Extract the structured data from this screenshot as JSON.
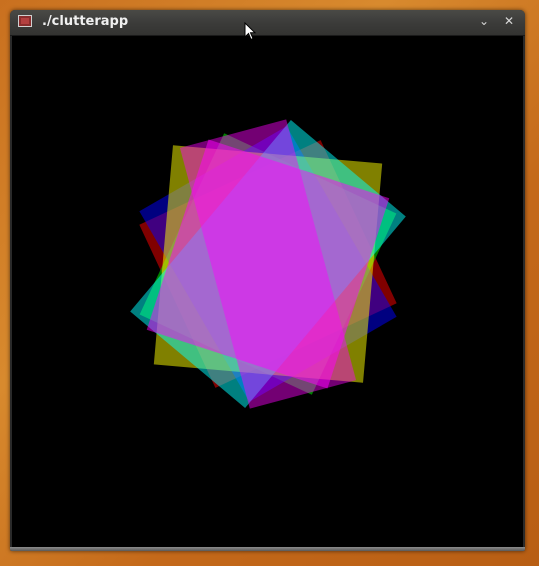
{
  "window": {
    "title": "./clutterapp",
    "minimize_glyph": "⌄",
    "close_glyph": "✕"
  },
  "stage": {
    "background": "#000000",
    "rectangle_colors": [
      "#ff0000",
      "#00ff00",
      "#0000ff",
      "#ffff00",
      "#00ffff",
      "#ff00ff"
    ]
  },
  "icons": {
    "app": "app-window-icon",
    "minimize": "chevron-down-icon",
    "close": "close-icon",
    "pointer": "mouse-pointer-icon"
  }
}
